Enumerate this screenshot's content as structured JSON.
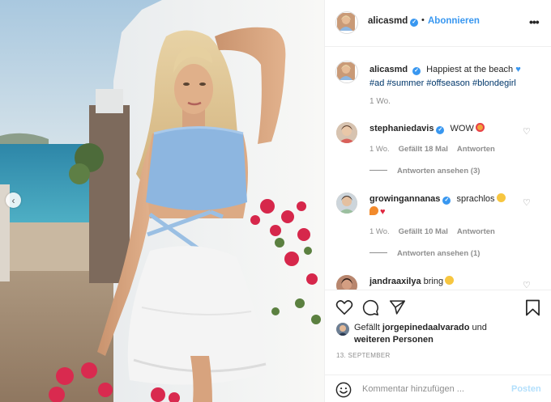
{
  "post": {
    "username": "alicasmd",
    "follow_label": "Abonnieren",
    "header_separator": "•",
    "more_icon": "more-options-icon",
    "caption_text": "Happiest at the beach",
    "caption_hashtags": "#ad #summer #offseason #blondegirl",
    "caption_time": "1 Wo."
  },
  "comments": [
    {
      "username": "stephaniedavis",
      "text": "WOW",
      "time": "1 Wo.",
      "likes": "Gefällt 18 Mal",
      "reply_label": "Antworten",
      "view_replies": "Antworten ansehen (3)"
    },
    {
      "username": "growingannanas",
      "text": "sprachlos",
      "time": "1 Wo.",
      "likes": "Gefällt 10 Mal",
      "reply_label": "Antworten",
      "view_replies": "Antworten ansehen (1)"
    },
    {
      "username": "jandraaxilya",
      "text": "bring"
    }
  ],
  "actions": {
    "liked_by_prefix": "Gefällt",
    "liked_by_user": "jorgepinedaalvarado",
    "liked_by_suffix": "und",
    "liked_by_others": "weiteren Personen",
    "date": "13. SEPTEMBER"
  },
  "comment_box": {
    "placeholder": "Kommentar hinzufügen ...",
    "post_label": "Posten"
  },
  "colors": {
    "accent": "#3897f0",
    "hashtag": "#00376b",
    "muted": "#8e8e8e",
    "post_disabled": "#b2dffc"
  }
}
